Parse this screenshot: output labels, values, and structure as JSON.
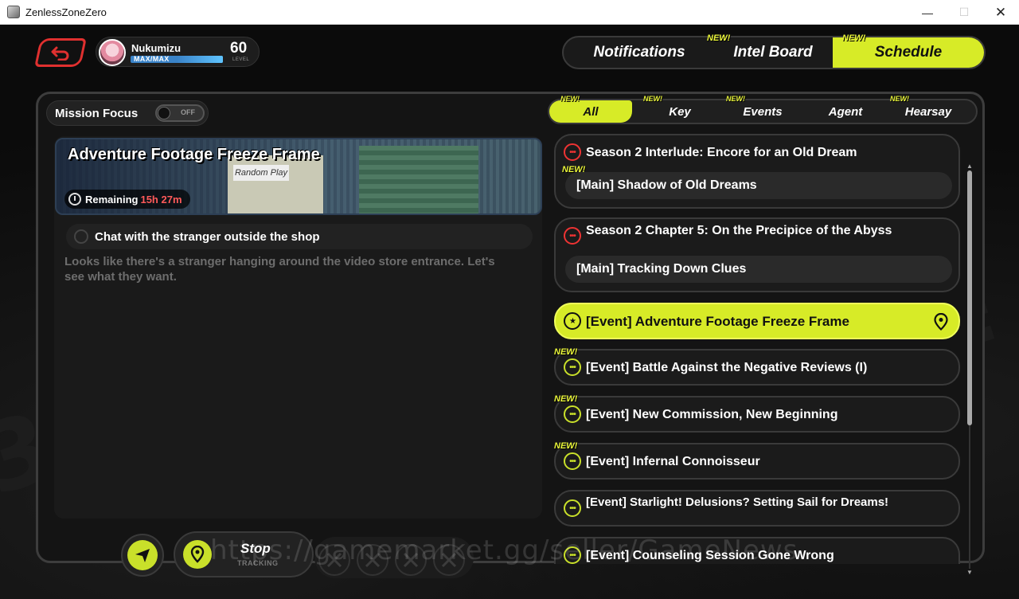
{
  "window": {
    "title": "ZenlessZoneZero",
    "minimize": "—",
    "maximize": "☐",
    "close": "✕"
  },
  "profile": {
    "name": "Nukumizu",
    "stamina": "MAX/MAX",
    "level": "60",
    "level_caption": "LEVEL"
  },
  "topnav": {
    "tabs": [
      {
        "label": "Notifications",
        "new": ""
      },
      {
        "label": "Intel Board",
        "new": "NEW!"
      },
      {
        "label": "Schedule",
        "new": "NEW!"
      }
    ],
    "active": "Schedule"
  },
  "mission_focus": {
    "label": "Mission Focus",
    "toggle": "OFF"
  },
  "categories": [
    {
      "label": "All",
      "new": "NEW!"
    },
    {
      "label": "Key",
      "new": "NEW!"
    },
    {
      "label": "Events",
      "new": "NEW!"
    },
    {
      "label": "Agent",
      "new": ""
    },
    {
      "label": "Hearsay",
      "new": "NEW!"
    }
  ],
  "detail": {
    "title": "Adventure Footage Freeze Frame",
    "banner_sign": "Random Play",
    "remaining_label": "Remaining",
    "remaining_time": "15h 27m",
    "objective": "Chat with the stranger outside the shop",
    "description": "Looks like there's a stranger hanging around the video store entrance. Let's see what they want."
  },
  "controls": {
    "stop": "Stop",
    "stop_caption": "TRACKING"
  },
  "quests": [
    {
      "title": "Season 2 Interlude: Encore for an Old Dream",
      "sub": "[Main] Shadow of Old Dreams",
      "new": "NEW!",
      "type": "main"
    },
    {
      "title": "Season 2 Chapter 5: On the Precipice of the Abyss",
      "sub": "[Main] Tracking Down Clues",
      "new": "",
      "type": "main"
    },
    {
      "title": "[Event] Adventure Footage Freeze Frame",
      "new": "",
      "type": "active"
    },
    {
      "title": "[Event] Battle Against the Negative Reviews (I)",
      "new": "NEW!",
      "type": "event"
    },
    {
      "title": "[Event] New Commission, New Beginning",
      "new": "NEW!",
      "type": "event"
    },
    {
      "title": "[Event] Infernal Connoisseur",
      "new": "NEW!",
      "type": "event"
    },
    {
      "title": "[Event] Starlight! Delusions? Setting Sail for Dreams!",
      "new": "",
      "type": "event"
    },
    {
      "title": "[Event] Counseling Session Gone Wrong",
      "new": "",
      "type": "event"
    }
  ],
  "watermark": "https://gamemarket.gg/seller/GameNews",
  "colors": {
    "accent": "#d7eb27",
    "alert": "#e33333",
    "panel": "#141414"
  }
}
